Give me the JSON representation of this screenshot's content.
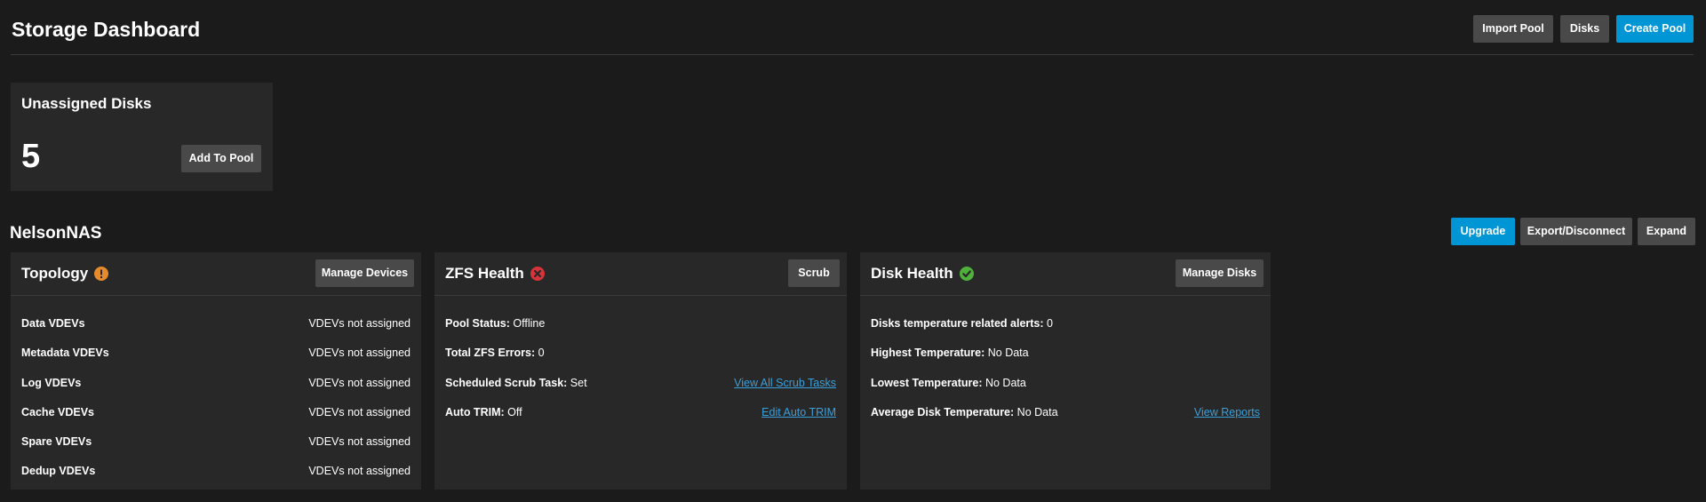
{
  "header": {
    "title": "Storage Dashboard",
    "import_pool": "Import Pool",
    "disks": "Disks",
    "create_pool": "Create Pool"
  },
  "unassigned": {
    "title": "Unassigned Disks",
    "count": "5",
    "add_to_pool": "Add To Pool"
  },
  "pool": {
    "name": "NelsonNAS",
    "upgrade": "Upgrade",
    "export": "Export/Disconnect",
    "expand": "Expand",
    "status_colors": {
      "warning": "#e68a2e",
      "error": "#d6343a",
      "ok": "#4fb13b"
    }
  },
  "topology": {
    "title": "Topology",
    "status_icon": "warning-icon",
    "manage": "Manage Devices",
    "rows": [
      {
        "label": "Data VDEVs",
        "value": "VDEVs not assigned"
      },
      {
        "label": "Metadata VDEVs",
        "value": "VDEVs not assigned"
      },
      {
        "label": "Log VDEVs",
        "value": "VDEVs not assigned"
      },
      {
        "label": "Cache VDEVs",
        "value": "VDEVs not assigned"
      },
      {
        "label": "Spare VDEVs",
        "value": "VDEVs not assigned"
      },
      {
        "label": "Dedup VDEVs",
        "value": "VDEVs not assigned"
      }
    ]
  },
  "zfs": {
    "title": "ZFS Health",
    "status_icon": "error-icon",
    "scrub": "Scrub",
    "rows": [
      {
        "label": "Pool Status:",
        "value": "Offline",
        "link": ""
      },
      {
        "label": "Total ZFS Errors:",
        "value": "0",
        "link": ""
      },
      {
        "label": "Scheduled Scrub Task:",
        "value": "Set",
        "link": "View All Scrub Tasks"
      },
      {
        "label": "Auto TRIM:",
        "value": "Off",
        "link": "Edit Auto TRIM"
      }
    ]
  },
  "disk_health": {
    "title": "Disk Health",
    "status_icon": "check-icon",
    "manage": "Manage Disks",
    "rows": [
      {
        "label": "Disks temperature related alerts:",
        "value": "0",
        "link": ""
      },
      {
        "label": "Highest Temperature:",
        "value": "No Data",
        "link": ""
      },
      {
        "label": "Lowest Temperature:",
        "value": "No Data",
        "link": ""
      },
      {
        "label": "Average Disk Temperature:",
        "value": "No Data",
        "link": "View Reports"
      }
    ]
  }
}
